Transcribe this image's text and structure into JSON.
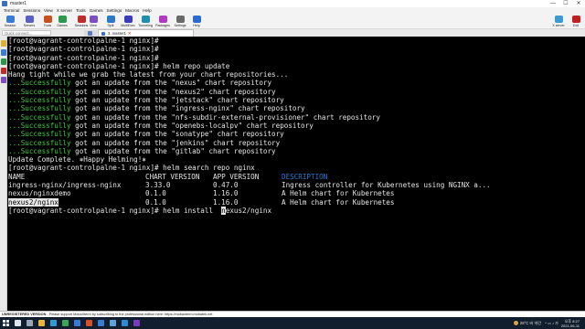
{
  "window": {
    "title": "master1",
    "minimize": "—",
    "maximize": "☐",
    "close": "✕"
  },
  "menu": [
    "Terminal",
    "Sessions",
    "View",
    "X server",
    "Tools",
    "Games",
    "Settings",
    "Macros",
    "Help"
  ],
  "toolbar": [
    {
      "label": "Session",
      "color": "#3a7bd5"
    },
    {
      "label": "Servers",
      "color": "#5a5fc8"
    },
    {
      "label": "Tools",
      "color": "#c8501e"
    },
    {
      "label": "Games",
      "color": "#2a9a4a"
    },
    {
      "label": "Sessions",
      "color": "#c02a2a"
    },
    {
      "label": "View",
      "color": "#7a4fc0"
    },
    {
      "label": "Split",
      "color": "#2a7ac8"
    },
    {
      "label": "MultiExec",
      "color": "#3a3ac0"
    },
    {
      "label": "Tunneling",
      "color": "#1e8fb0"
    },
    {
      "label": "Packages",
      "color": "#b03ac0"
    },
    {
      "label": "Settings",
      "color": "#6a6a6a"
    },
    {
      "label": "Help",
      "color": "#2a6ad5"
    },
    {
      "label": "X server",
      "color": "#3a9ad5"
    },
    {
      "label": "Exit",
      "color": "#c02020"
    }
  ],
  "quick_connect": {
    "placeholder": "Quick connect..."
  },
  "tab": {
    "label": "3. master1",
    "close": "✕"
  },
  "terminal": {
    "prompt": "[root@vagrant-controlpalne-1 nginx]#",
    "cmd_update": " helm repo update",
    "hang_tight": "Hang tight while we grab the latest from your chart repositories...",
    "success_prefix": "...Successfully",
    "success_middle": " got an update from the ",
    "chart_repo": " chart repository",
    "repos": [
      "\"nexus\"",
      "\"nexus2\"",
      "\"jetstack\"",
      "\"ingress-nginx\"",
      "\"nfs-subdir-external-provisioner\"",
      "\"openebs-localpv\"",
      "\"sonatype\"",
      "\"jenkins\"",
      "\"gitlab\""
    ],
    "update_complete": "Update Complete. ⎈Happy Helming!⎈",
    "cmd_search": " helm search repo nginx",
    "headers": [
      "NAME",
      "CHART VERSION",
      "APP VERSION",
      "DESCRIPTION"
    ],
    "rows": [
      [
        "ingress-nginx/ingress-nginx",
        "3.33.0",
        "0.47.0",
        "Ingress controller for Kubernetes using NGINX a..."
      ],
      [
        "nexus/nginxdemo",
        "0.1.0",
        "1.16.0",
        "A Helm chart for Kubernetes"
      ],
      [
        "nexus2/nginx",
        "0.1.0",
        "1.16.0",
        "A Helm chart for Kubernetes"
      ]
    ],
    "cmd_install_pre": " helm install  ",
    "cmd_install_cursor": "n",
    "cmd_install_post": "exus2/nginx"
  },
  "status_bar": {
    "bold": "UNREGISTERED VERSION",
    "text": "  -  Please support MobaXterm by subscribing to the professional edition here:  https://mobaxterm.mobatek.net"
  },
  "taskbar": {
    "weather": "28°C 비 약간",
    "sys": "^ ▭ ♪ 가",
    "time": "오후 8:27",
    "date": "2021-06-11",
    "icons": [
      {
        "name": "search-icon",
        "color": "#dfe6ee"
      },
      {
        "name": "task-view-icon",
        "color": "#9aa6b4"
      },
      {
        "name": "file-explorer-icon",
        "color": "#e8b73a"
      },
      {
        "name": "edge-icon",
        "color": "#2e9bd6"
      },
      {
        "name": "chrome-icon",
        "color": "#3aa657"
      },
      {
        "name": "store-icon",
        "color": "#3a7bd5"
      },
      {
        "name": "powerpoint-icon",
        "color": "#d2502a"
      },
      {
        "name": "terminal-icon",
        "color": "#3a7bd5"
      },
      {
        "name": "mobaxterm-icon",
        "color": "#5fa0e0"
      },
      {
        "name": "vscode-icon",
        "color": "#2a8ad5"
      },
      {
        "name": "app-icon",
        "color": "#7a3ac0"
      }
    ]
  }
}
